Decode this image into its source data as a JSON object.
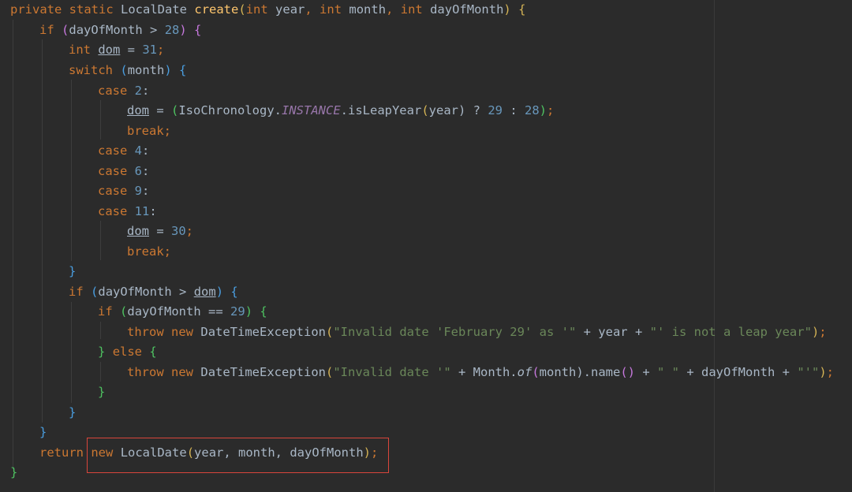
{
  "code_lines": [
    [
      "private",
      "static",
      "LocalDate",
      "create",
      "(",
      "int",
      "year",
      ", ",
      "int",
      "month",
      ", ",
      "int",
      "dayOfMonth",
      ")",
      "{"
    ],
    [
      "if",
      "(",
      "dayOfMonth > ",
      "28",
      ")",
      "{"
    ],
    [
      "int",
      "dom",
      " = ",
      "31",
      ";"
    ],
    [
      "switch",
      "(",
      "month",
      ")",
      "{"
    ],
    [
      "case",
      "2",
      ":"
    ],
    [
      "dom",
      " = ",
      "(",
      "IsoChronology.",
      "INSTANCE",
      ".isLeapYear",
      "(",
      "year",
      ") ? ",
      "29",
      " : ",
      "28",
      ")",
      ";"
    ],
    [
      "break",
      ";"
    ],
    [
      "case",
      "4",
      ":"
    ],
    [
      "case",
      "6",
      ":"
    ],
    [
      "case",
      "9",
      ":"
    ],
    [
      "case",
      "11",
      ":"
    ],
    [
      "dom",
      " = ",
      "30",
      ";"
    ],
    [
      "break",
      ";"
    ],
    [
      "}"
    ],
    [
      "if",
      "(",
      "dayOfMonth > ",
      "dom",
      ")",
      "{"
    ],
    [
      "if",
      "(",
      "dayOfMonth == ",
      "29",
      ")",
      "{"
    ],
    [
      "throw",
      "new",
      "DateTimeException",
      "(",
      "\"Invalid date 'February 29' as '\"",
      " + year + ",
      "\"' is not a leap year\"",
      ")",
      ";"
    ],
    [
      "}",
      "else",
      "{"
    ],
    [
      "throw",
      "new",
      "DateTimeException",
      "(",
      "\"Invalid date '\"",
      " + Month.",
      "of",
      "(",
      "month",
      ").name",
      "()",
      " + ",
      "\" \"",
      " + dayOfMonth + ",
      "\"'\"",
      ")",
      ";"
    ],
    [
      "}"
    ],
    [
      "}"
    ],
    [
      "}"
    ],
    [
      "return",
      "new",
      "LocalDate",
      "(",
      "year, month, dayOfMonth",
      ")",
      ";"
    ],
    [
      "}"
    ]
  ]
}
